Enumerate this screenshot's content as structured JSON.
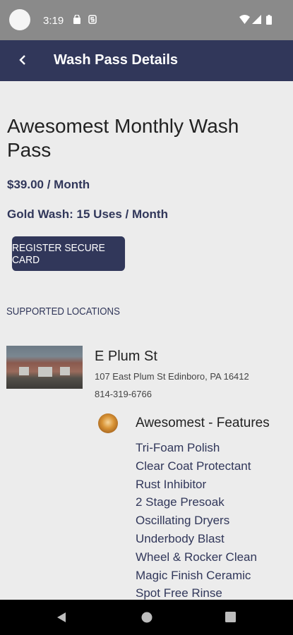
{
  "status_bar": {
    "time": "3:19",
    "icons": [
      "notification-lock-icon",
      "app-s-icon",
      "wifi-icon",
      "signal-icon",
      "battery-icon"
    ]
  },
  "app_bar": {
    "title": "Wash Pass Details",
    "back_icon": "chevron-left-icon"
  },
  "pass": {
    "title": "Awesomest Monthly Wash Pass",
    "price": "$39.00 / Month",
    "uses": "Gold Wash: 15 Uses / Month",
    "register_button": "REGISTER SECURE CARD"
  },
  "locations": {
    "header": "SUPPORTED LOCATIONS",
    "items": [
      {
        "name": "E Plum St",
        "address": "107 East Plum St Edinboro, PA 16412",
        "phone": "814-319-6766",
        "wash": {
          "title": "Awesomest - Features",
          "features": [
            "Tri-Foam Polish",
            "Clear Coat Protectant",
            "Rust Inhibitor",
            "2 Stage Presoak",
            "Oscillating Dryers",
            "Underbody Blast",
            "Wheel & Rocker Clean",
            "Magic Finish Ceramic",
            "Spot Free Rinse"
          ]
        }
      }
    ]
  },
  "nav_bar": {
    "buttons": [
      "back-triangle-icon",
      "home-circle-icon",
      "recents-square-icon"
    ]
  },
  "colors": {
    "primary": "#31375a",
    "status_bar": "#8a8a8a",
    "background": "#ececec"
  }
}
